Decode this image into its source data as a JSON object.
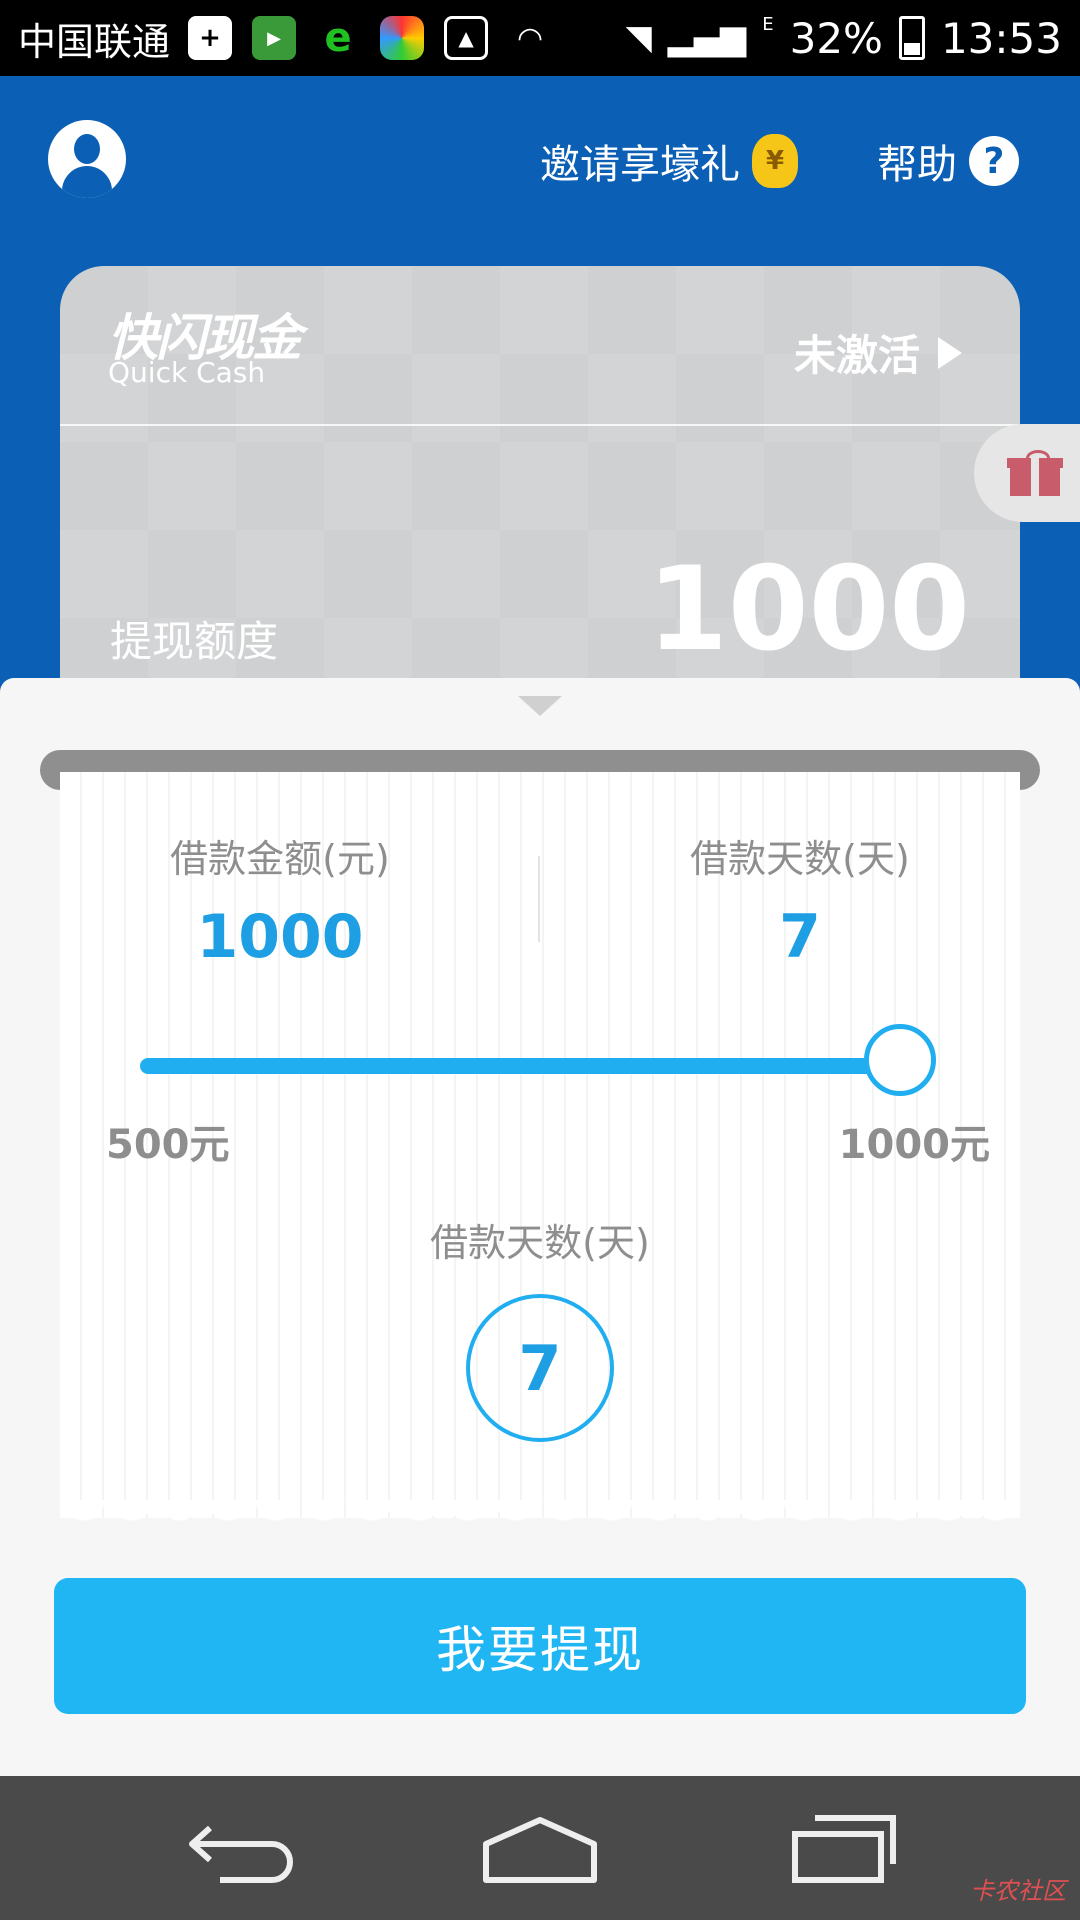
{
  "status_bar": {
    "carrier": "中国联通",
    "battery": "32%",
    "time": "13:53",
    "network": "E"
  },
  "header": {
    "invite_label": "邀请享壕礼",
    "invite_badge": "¥",
    "help_label": "帮助",
    "help_icon_text": "?"
  },
  "card": {
    "brand_cn": "快闪现金",
    "brand_en": "Quick Cash",
    "status": "未激活",
    "limit_label": "提现额度",
    "limit_value": "1000"
  },
  "loan": {
    "amount_label": "借款金额(元)",
    "amount_value": "1000",
    "days_label": "借款天数(天)",
    "days_value": "7",
    "slider_min": "500元",
    "slider_max": "1000元",
    "slider_fraction": 1.0,
    "days_section_label": "借款天数(天)",
    "days_option": "7"
  },
  "withdraw_button": "我要提现",
  "watermark": "卡农社区",
  "colors": {
    "header_bg": "#0b5fb4",
    "accent": "#21aef0",
    "button": "#20b6f4"
  }
}
